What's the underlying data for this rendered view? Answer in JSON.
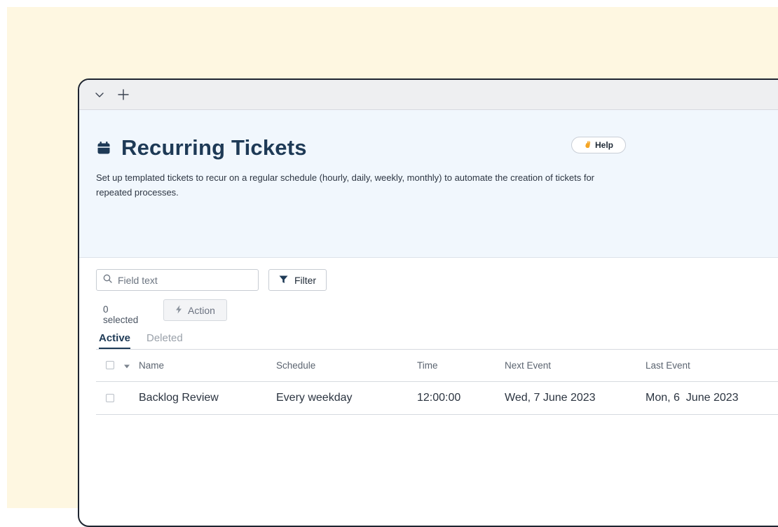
{
  "page": {
    "title": "Recurring Tickets",
    "description": "Set up templated tickets to recur on a regular schedule (hourly, daily, weekly, monthly) to automate the creation of tickets for repeated processes.",
    "help_label": "Help"
  },
  "toolbar": {
    "search_placeholder": "Field text",
    "filter_label": "Filter",
    "selected_text": "0 selected",
    "action_label": "Action"
  },
  "tabs": [
    {
      "label": "Active",
      "active": true
    },
    {
      "label": "Deleted",
      "active": false
    }
  ],
  "table": {
    "columns": [
      "Name",
      "Schedule",
      "Time",
      "Next Event",
      "Last Event"
    ],
    "rows": [
      {
        "name": "Backlog Review",
        "schedule": "Every weekday",
        "time": "12:00:00",
        "next_event": "Wed, 7 June 2023",
        "last_event": "Mon, 6  June 2023"
      }
    ]
  },
  "icons": {
    "tab_bar": [
      "chevron-down-icon",
      "plus-icon"
    ],
    "title": "calendar-icon",
    "help": "waving-hand-icon",
    "search": "search-icon",
    "filter": "funnel-icon",
    "action": "lightning-icon",
    "sort": "caret-down-icon"
  },
  "colors": {
    "backdrop": "#fef7e1",
    "hero_background": "#f1f7fd",
    "title": "#1e3a56",
    "window_border": "#1e2430"
  }
}
